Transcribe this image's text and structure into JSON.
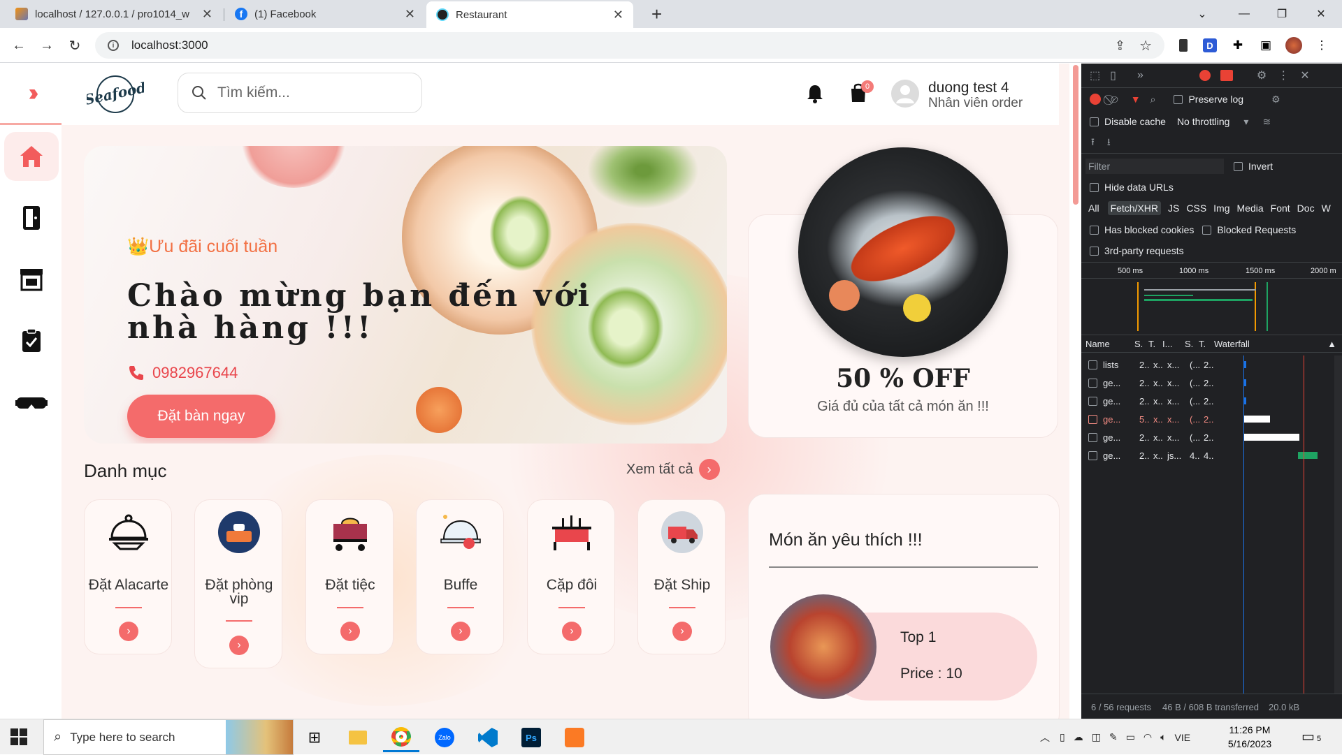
{
  "browser": {
    "tabs": [
      {
        "title": "localhost / 127.0.0.1 / pro1014_w",
        "active": false
      },
      {
        "title": "(1) Facebook",
        "active": false
      },
      {
        "title": "Restaurant",
        "active": true
      }
    ],
    "new_tab": "+",
    "url": "localhost:3000"
  },
  "app": {
    "logo_text": "Seafood",
    "search_placeholder": "Tìm kiếm...",
    "cart_count": "0",
    "user_name": "duong test 4",
    "user_role": "Nhân viên order",
    "sidebar": [
      "home-icon",
      "menu-book-icon",
      "store-icon",
      "clipboard-check-icon",
      "vr-icon"
    ],
    "hero": {
      "tag": "👑Ưu đãi cuối tuần",
      "title": "Chào mừng bạn đến với nhà hàng !!!",
      "phone": "0982967644",
      "cta": "Đặt bàn ngay"
    },
    "promo": {
      "title": "50 % OFF",
      "subtitle": "Giá đủ của tất cả món ăn !!!"
    },
    "categories_section": {
      "title": "Danh mục",
      "see_all": "Xem tất cả",
      "items": [
        {
          "label": "Đặt Alacarte",
          "icon": "cloche-icon"
        },
        {
          "label": "Đặt phòng vip",
          "icon": "vip-room-icon"
        },
        {
          "label": "Đặt tiệc",
          "icon": "party-cart-icon"
        },
        {
          "label": "Buffe",
          "icon": "buffet-icon"
        },
        {
          "label": "Cặp đôi",
          "icon": "couple-table-icon"
        },
        {
          "label": "Đặt Ship",
          "icon": "delivery-truck-icon"
        }
      ]
    },
    "favorites": {
      "title": "Món ăn yêu thích !!!",
      "top_label": "Top 1",
      "price_label": "Price : 10"
    }
  },
  "devtools": {
    "preserve_log": "Preserve log",
    "disable_cache": "Disable cache",
    "throttling": "No throttling",
    "filter_placeholder": "Filter",
    "invert": "Invert",
    "hide_data_urls": "Hide data URLs",
    "types": [
      "All",
      "Fetch/XHR",
      "JS",
      "CSS",
      "Img",
      "Media",
      "Font",
      "Doc",
      "W"
    ],
    "has_blocked_cookies": "Has blocked cookies",
    "blocked_requests": "Blocked Requests",
    "third_party": "3rd-party requests",
    "timeline_ticks": [
      "500 ms",
      "1000 ms",
      "1500 ms",
      "2000 m"
    ],
    "columns": [
      "Name",
      "S.",
      "T.",
      "I...",
      "S.",
      "T.",
      "Waterfall"
    ],
    "requests": [
      {
        "name": "lists",
        "s": "2..",
        "t": "x..",
        "i": "x...",
        "s2": "(...",
        "t2": "2..",
        "error": false
      },
      {
        "name": "ge...",
        "s": "2..",
        "t": "x..",
        "i": "x...",
        "s2": "(...",
        "t2": "2..",
        "error": false
      },
      {
        "name": "ge...",
        "s": "2..",
        "t": "x..",
        "i": "x...",
        "s2": "(...",
        "t2": "2..",
        "error": false
      },
      {
        "name": "ge...",
        "s": "5..",
        "t": "x..",
        "i": "x...",
        "s2": "(...",
        "t2": "2..",
        "error": true
      },
      {
        "name": "ge...",
        "s": "2..",
        "t": "x..",
        "i": "x...",
        "s2": "(...",
        "t2": "2..",
        "error": false
      },
      {
        "name": "ge...",
        "s": "2..",
        "t": "x..",
        "i": "js...",
        "s2": "4..",
        "t2": "4..",
        "error": false
      }
    ],
    "status_requests": "6 / 56 requests",
    "status_transferred": "46 B / 608 B transferred",
    "status_size": "20.0 kB"
  },
  "taskbar": {
    "search_placeholder": "Type here to search",
    "time": "11:26 PM",
    "date": "5/16/2023",
    "lang": "VIE",
    "notification_count": "5"
  },
  "colors": {
    "accent": "#f46b6b",
    "accent_light": "#fdeceb",
    "devtools_bg": "#202124"
  }
}
